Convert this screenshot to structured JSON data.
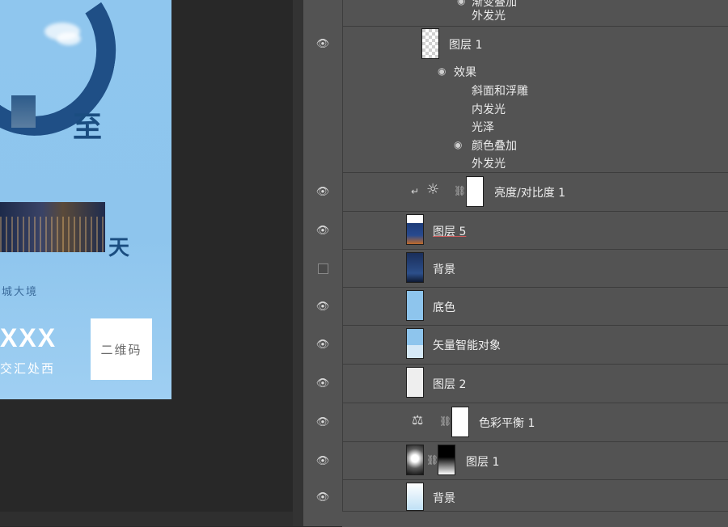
{
  "canvas": {
    "title_chars": [
      "至",
      "天"
    ],
    "subtitle": "城大境",
    "brand": "XXX",
    "address": "交汇处西",
    "qr_label": "二维码"
  },
  "layers": {
    "top_effects": [
      "渐变叠加",
      "外发光"
    ],
    "rows": [
      {
        "name": "图层 1",
        "visible": true,
        "effects_label": "效果",
        "effects": [
          "斜面和浮雕",
          "内发光",
          "光泽",
          "颜色叠加",
          "外发光"
        ]
      },
      {
        "name": "亮度/对比度 1",
        "visible": true,
        "type": "adjustment",
        "icon": "brightness-contrast-icon"
      },
      {
        "name": "图层 5",
        "visible": true
      },
      {
        "name": "背景",
        "visible": false
      },
      {
        "name": "底色",
        "visible": true
      },
      {
        "name": "矢量智能对象",
        "visible": true
      },
      {
        "name": "图层 2",
        "visible": true
      },
      {
        "name": "色彩平衡 1",
        "visible": true,
        "type": "adjustment",
        "icon": "color-balance-icon"
      },
      {
        "name": "图层 1",
        "visible": true
      },
      {
        "name": "背景",
        "visible": true
      }
    ]
  },
  "colors": {
    "panel_bg": "#535353",
    "canvas_bg": "#282828",
    "doc_bg": "#8fc6ee",
    "brand_blue": "#1a4d80"
  }
}
